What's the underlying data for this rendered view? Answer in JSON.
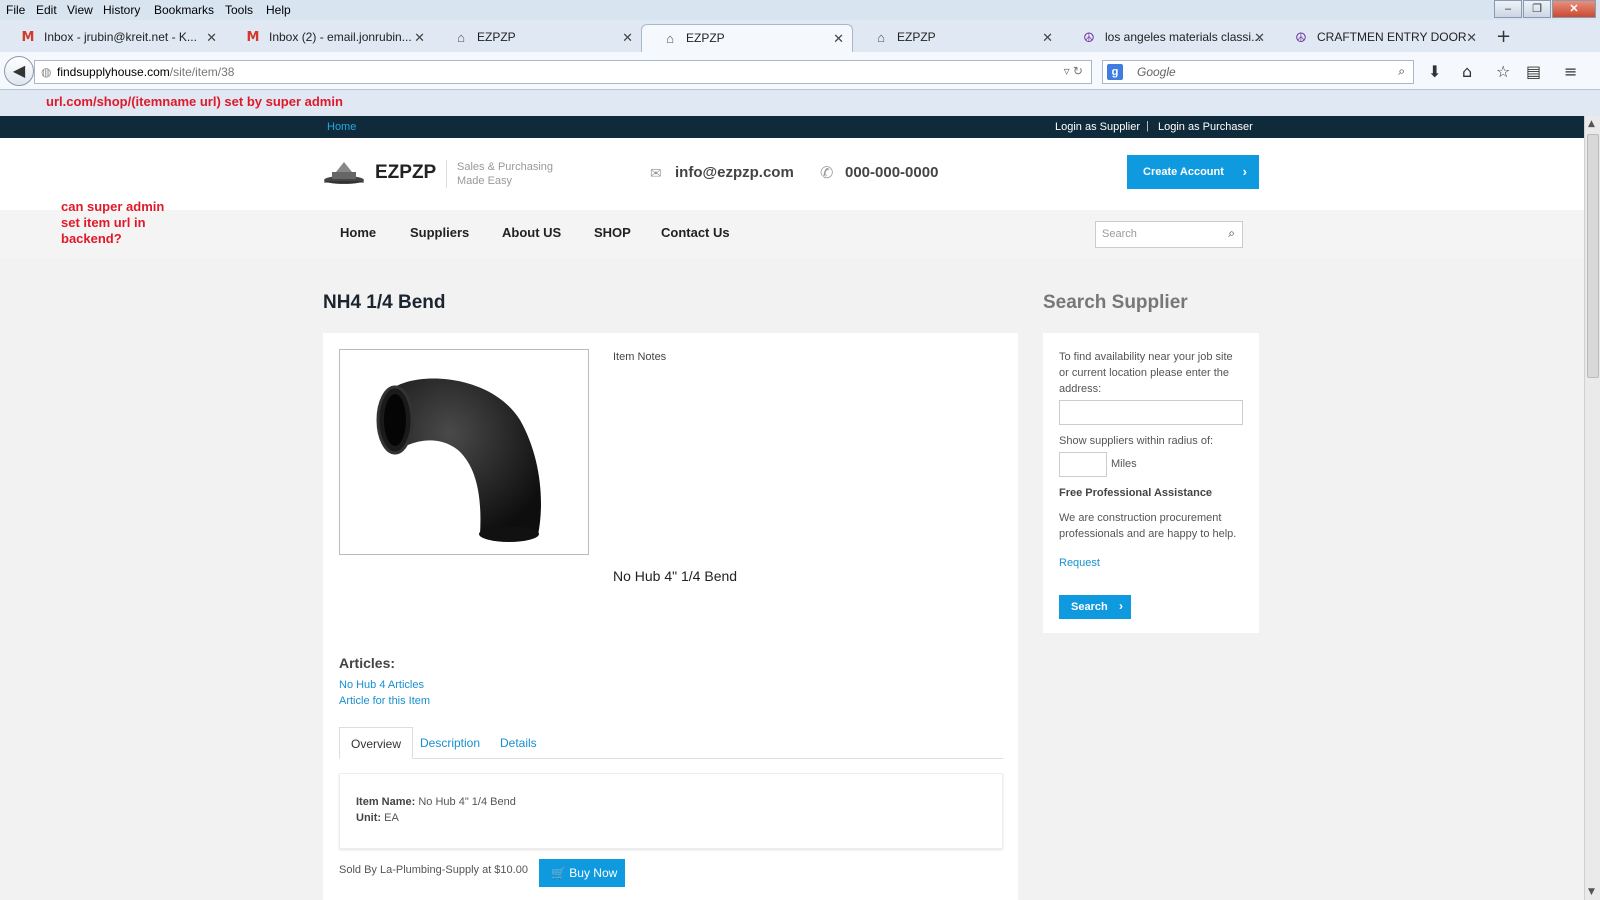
{
  "menu": [
    "File",
    "Edit",
    "View",
    "History",
    "Bookmarks",
    "Tools",
    "Help"
  ],
  "tabs": [
    {
      "label": "Inbox - jrubin@kreit.net - K...",
      "icon": "gmail-icon"
    },
    {
      "label": "Inbox (2) - email.jonrubin...",
      "icon": "gmail-icon"
    },
    {
      "label": "EZPZP",
      "icon": "home-icon"
    },
    {
      "label": "EZPZP",
      "icon": "home-icon"
    },
    {
      "label": "EZPZP",
      "icon": "home-icon"
    },
    {
      "label": "los angeles materials classi...",
      "icon": "peace-icon"
    },
    {
      "label": "CRAFTMEN ENTRY DOOR",
      "icon": "peace-icon"
    }
  ],
  "active_tab_index": 3,
  "url": {
    "host": "findsupplyhouse.com",
    "path": "/site/item/38"
  },
  "search_engine_placeholder": "Google",
  "annotations": {
    "top": "url.com/shop/(itemname url) set by super admin",
    "side_line1": "can super admin",
    "side_line2": "set item url in",
    "side_line3": "backend?"
  },
  "topbar": {
    "home": "Home",
    "login_supplier": "Login as Supplier",
    "separator": "|",
    "login_purchaser": "Login as Purchaser"
  },
  "header": {
    "brand": "EZPZP",
    "tagline_line1": "Sales & Purchasing",
    "tagline_line2": "Made Easy",
    "email": "info@ezpzp.com",
    "phone": "000-000-0000",
    "create_account": "Create Account"
  },
  "nav": [
    "Home",
    "Suppliers",
    "About US",
    "SHOP",
    "Contact Us"
  ],
  "site_search_placeholder": "Search",
  "product": {
    "title": "NH4 1/4 Bend",
    "item_notes": "Item Notes",
    "description": "No Hub 4\" 1/4 Bend",
    "articles_heading": "Articles:",
    "articles": [
      "No Hub 4 Articles",
      "Article for this Item"
    ],
    "tabs": [
      "Overview",
      "Description",
      "Details"
    ],
    "item_name_label": "Item Name:",
    "item_name_value": "No Hub 4\" 1/4 Bend",
    "unit_label": "Unit:",
    "unit_value": "EA",
    "sold_by": "Sold By La-Plumbing-Supply at $10.00",
    "buy_now": "Buy Now"
  },
  "sidebar": {
    "title": "Search Supplier",
    "intro": "To find availability near your job site or current location please enter the address:",
    "radius_label": "Show suppliers within radius of:",
    "miles": "Miles",
    "fpa_heading": "Free Professional Assistance",
    "fpa_text": "We are construction procurement professionals and are happy to help.",
    "request_link": "Request",
    "search_button": "Search"
  }
}
